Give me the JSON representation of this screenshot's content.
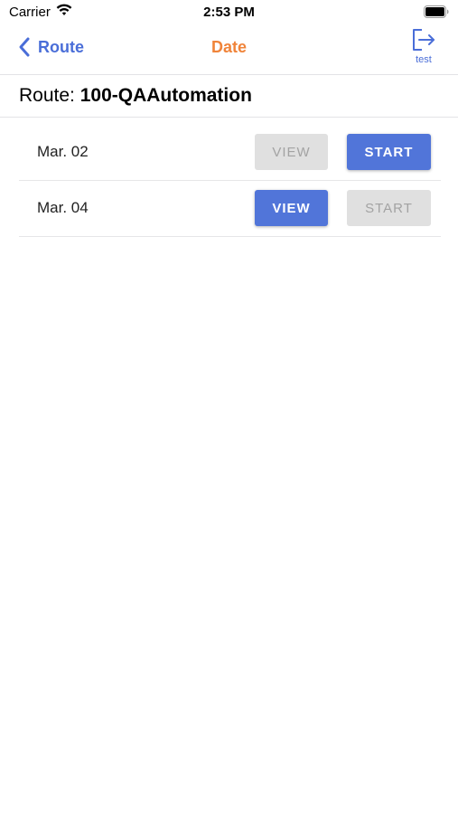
{
  "status_bar": {
    "carrier": "Carrier",
    "time": "2:53 PM",
    "wifi_icon": "wifi-icon",
    "battery_icon": "battery-icon"
  },
  "nav": {
    "back_label": "Route",
    "back_icon": "chevron-left-icon",
    "title": "Date",
    "logout_icon": "logout-icon",
    "logout_label": "test"
  },
  "route_header": {
    "prefix": "Route: ",
    "name": "100-QAAutomation"
  },
  "rows": [
    {
      "date": "Mar. 02",
      "view_label": "VIEW",
      "view_state": "disabled",
      "start_label": "START",
      "start_state": "active"
    },
    {
      "date": "Mar. 04",
      "view_label": "VIEW",
      "view_state": "active",
      "start_label": "START",
      "start_state": "disabled"
    }
  ],
  "colors": {
    "accent_blue": "#5175d9",
    "nav_blue": "#4a6ed8",
    "title_orange": "#f0843a",
    "disabled_bg": "#e0e0e0",
    "disabled_text": "#a3a3a3"
  }
}
